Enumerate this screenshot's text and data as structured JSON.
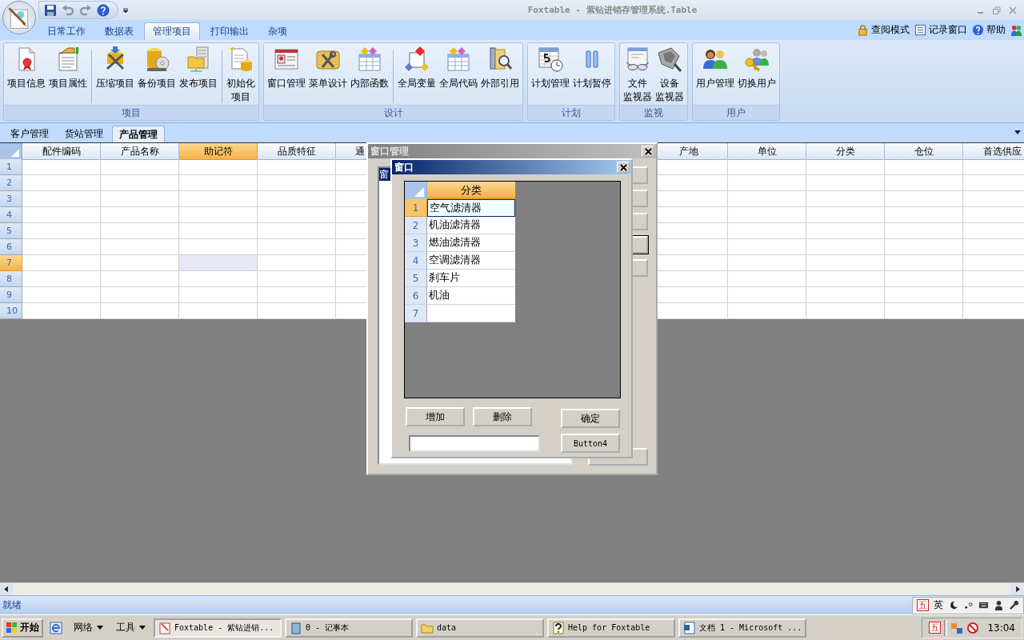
{
  "app": {
    "title": "Foxtable - 紫钻进销存管理系统.Table"
  },
  "ribbon_tabs": [
    {
      "label": "日常工作",
      "selected": false
    },
    {
      "label": "数据表",
      "selected": false
    },
    {
      "label": "管理项目",
      "selected": true
    },
    {
      "label": "打印输出",
      "selected": false
    },
    {
      "label": "杂项",
      "selected": false
    }
  ],
  "ribbon_links": [
    {
      "label": "查阅模式"
    },
    {
      "label": "记录窗口"
    },
    {
      "label": "帮助"
    }
  ],
  "ribbon_groups": [
    {
      "label": "项目",
      "sections": [
        [
          {
            "label": "项目信息"
          },
          {
            "label": "项目属性"
          }
        ],
        [
          {
            "label": "压缩项目"
          },
          {
            "label": "备份项目"
          },
          {
            "label": "发布项目"
          }
        ],
        [
          {
            "label_lines": [
              "初始化",
              "项目"
            ]
          }
        ]
      ]
    },
    {
      "label": "设计",
      "sections": [
        [
          {
            "label": "窗口管理"
          },
          {
            "label": "菜单设计"
          },
          {
            "label": "内部函数"
          }
        ],
        [
          {
            "label": "全局变量"
          },
          {
            "label": "全局代码"
          },
          {
            "label": "外部引用"
          }
        ]
      ]
    },
    {
      "label": "计划",
      "sections": [
        [
          {
            "label": "计划管理"
          },
          {
            "label": "计划暂停"
          }
        ]
      ]
    },
    {
      "label": "监视",
      "sections": [
        [
          {
            "label_lines": [
              "文件",
              "监视器"
            ]
          },
          {
            "label_lines": [
              "设备",
              "监视器"
            ]
          }
        ]
      ]
    },
    {
      "label": "用户",
      "sections": [
        [
          {
            "label": "用户管理"
          },
          {
            "label": "切换用户"
          }
        ]
      ]
    }
  ],
  "sheet_tabs": [
    {
      "label": "客户管理",
      "selected": false
    },
    {
      "label": "货站管理",
      "selected": false
    },
    {
      "label": "产品管理",
      "selected": true
    }
  ],
  "table": {
    "columns": [
      {
        "label": "配件编码",
        "selected": false
      },
      {
        "label": "产品名称",
        "selected": false
      },
      {
        "label": "助记符",
        "selected": true
      },
      {
        "label": "品质特征",
        "selected": false
      },
      {
        "label": "通",
        "selected": false
      },
      {
        "label": "产地",
        "selected": false
      },
      {
        "label": "单位",
        "selected": false
      },
      {
        "label": "分类",
        "selected": false
      },
      {
        "label": "仓位",
        "selected": false
      },
      {
        "label": "首选供应",
        "selected": false
      }
    ],
    "rows": [
      {
        "number": "1",
        "selected": false
      },
      {
        "number": "2",
        "selected": false
      },
      {
        "number": "3",
        "selected": false
      },
      {
        "number": "4",
        "selected": false
      },
      {
        "number": "5",
        "selected": false
      },
      {
        "number": "6",
        "selected": false
      },
      {
        "number": "7",
        "selected": true
      },
      {
        "number": "8",
        "selected": false
      },
      {
        "number": "9",
        "selected": false
      },
      {
        "number": "10",
        "selected": false
      }
    ]
  },
  "outer_dialog": {
    "title": "窗口管理",
    "list_items": [
      {
        "label": "窗",
        "selected": true
      }
    ]
  },
  "inner_dialog": {
    "title": "窗口",
    "column": {
      "label": "分类",
      "selected": true
    },
    "rows": [
      {
        "number": "1",
        "value": "空气滤清器",
        "selected": true
      },
      {
        "number": "2",
        "value": "机油滤清器",
        "selected": false
      },
      {
        "number": "3",
        "value": "燃油滤清器",
        "selected": false
      },
      {
        "number": "4",
        "value": "空调滤清器",
        "selected": false
      },
      {
        "number": "5",
        "value": "刹车片",
        "selected": false
      },
      {
        "number": "6",
        "value": "机油",
        "selected": false
      },
      {
        "number": "7",
        "selected": false
      }
    ],
    "buttons": [
      "增加",
      "删除",
      "确定",
      "Button4"
    ]
  },
  "status_bar": {
    "text": "就绪",
    "ime": [
      "五",
      "英"
    ]
  },
  "taskbar": {
    "start": "开始",
    "menus": [
      "网络",
      "工具"
    ],
    "tasks": [
      {
        "label": "Foxtable - 紫钻进销...",
        "selected": true
      },
      {
        "label": "0 - 记事本",
        "selected": false
      },
      {
        "label": "data",
        "selected": false
      },
      {
        "label": "Help for Foxtable",
        "selected": false
      },
      {
        "label": "文档 1 - Microsoft ...",
        "selected": false
      }
    ],
    "tray_ime": "五",
    "clock": "13:04"
  }
}
